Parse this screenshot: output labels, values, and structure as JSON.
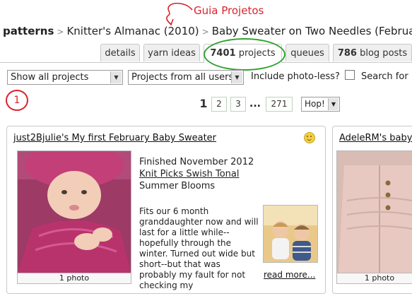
{
  "annotation": {
    "title": "Guia Projetos",
    "marker_number": "1",
    "color": "#d9232d",
    "highlight_color": "#2fa32f"
  },
  "breadcrumb": {
    "root": "patterns",
    "items": [
      "Knitter's Almanac (2010)",
      "Baby Sweater on Two Needles (February)"
    ]
  },
  "tabs": [
    {
      "label": "details"
    },
    {
      "label": "yarn ideas"
    },
    {
      "count": "7401",
      "label": "projects",
      "active": true
    },
    {
      "label": "queues"
    },
    {
      "count": "786",
      "label": "blog posts"
    }
  ],
  "filters": {
    "show": "Show all projects",
    "users": "Projects from all users",
    "include_photoless": "Include photo-less?",
    "search": "Search for"
  },
  "pagination": {
    "current": "1",
    "pages": [
      "2",
      "3"
    ],
    "ellipsis": "...",
    "last": "271",
    "hop": "Hop!"
  },
  "projects": [
    {
      "title": "just2Bjulie's My first February Baby Sweater",
      "finished": "Finished November 2012",
      "yarn": "Knit Picks Swish Tonal",
      "colorway": "Summer Blooms",
      "notes": "Fits our 6 month granddaughter now and will last for a little while--hopefully through the winter. Turned out wide but short--but that was probably my fault for not checking my",
      "read_more": "read more...",
      "photo_count": "1 photo",
      "icon": "smiley-icon"
    },
    {
      "title": "AdeleRM's baby",
      "photo_count": "1 photo"
    }
  ]
}
